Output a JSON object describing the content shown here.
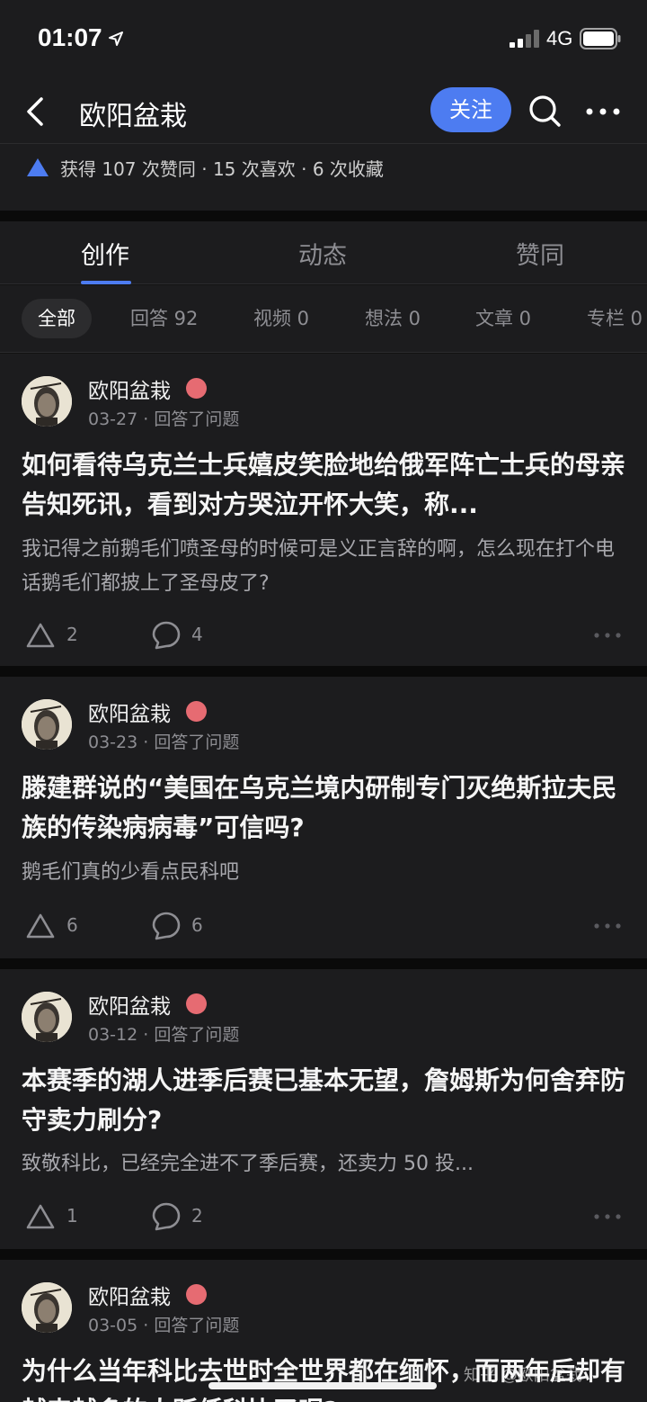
{
  "status_bar": {
    "time": "01:07",
    "network": "4G"
  },
  "header": {
    "title": "欧阳盆栽",
    "follow_label": "关注"
  },
  "stats": {
    "text": "获得 107 次赞同 · 15 次喜欢 · 6 次收藏"
  },
  "tabs": [
    {
      "label": "创作",
      "active": true
    },
    {
      "label": "动态",
      "active": false
    },
    {
      "label": "赞同",
      "active": false
    }
  ],
  "filters": [
    {
      "label": "全部",
      "active": true
    },
    {
      "label": "回答 92"
    },
    {
      "label": "视频 0"
    },
    {
      "label": "想法 0"
    },
    {
      "label": "文章 0"
    },
    {
      "label": "专栏 0"
    }
  ],
  "feed": [
    {
      "author": "欧阳盆栽",
      "meta": "03-27 · 回答了问题",
      "title": "如何看待乌克兰士兵嬉皮笑脸地给俄军阵亡士兵的母亲告知死讯，看到对方哭泣开怀大笑，称...",
      "excerpt": "我记得之前鹅毛们喷圣母的时候可是义正言辞的啊，怎么现在打个电话鹅毛们都披上了圣母皮了?",
      "upvotes": "2",
      "comments": "4"
    },
    {
      "author": "欧阳盆栽",
      "meta": "03-23 · 回答了问题",
      "title": "滕建群说的“美国在乌克兰境内研制专门灭绝斯拉夫民族的传染病病毒”可信吗?",
      "excerpt": "鹅毛们真的少看点民科吧",
      "upvotes": "6",
      "comments": "6"
    },
    {
      "author": "欧阳盆栽",
      "meta": "03-12 · 回答了问题",
      "title": "本赛季的湖人进季后赛已基本无望，詹姆斯为何舍弃防守卖力刷分?",
      "excerpt": "致敬科比，已经完全进不了季后赛，还卖力 50 投...",
      "upvotes": "1",
      "comments": "2"
    },
    {
      "author": "欧阳盆栽",
      "meta": "03-05 · 回答了问题",
      "title": "为什么当年科比去世时全世界都在缅怀，而两年后却有越来越多的人贬低科比了呢?"
    }
  ],
  "watermark": "知乎 @欧阳盆栽",
  "colors": {
    "accent": "#4d7cf1",
    "badge": "#e66b72",
    "background": "#1c1c1e"
  }
}
